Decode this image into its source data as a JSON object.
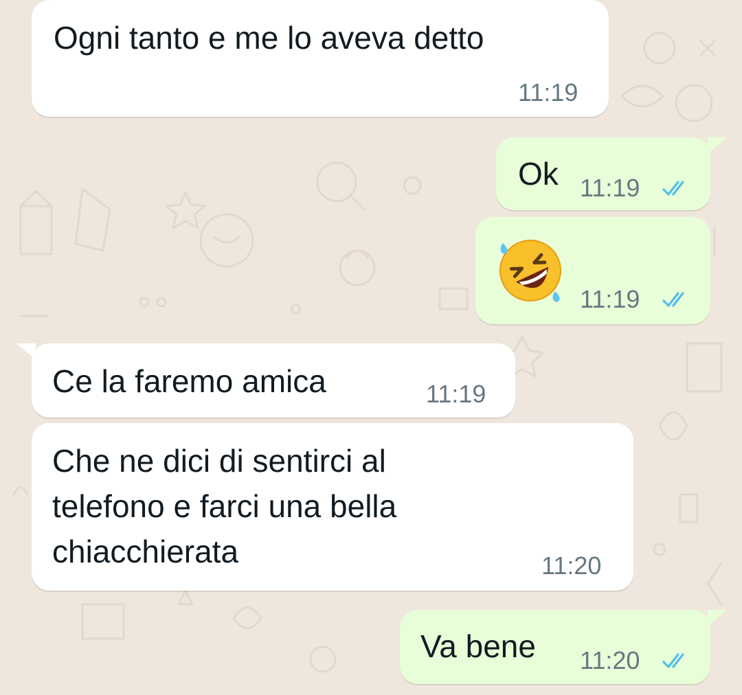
{
  "chat": {
    "messages": [
      {
        "direction": "incoming",
        "text": "Ogni tanto e me lo aveva detto",
        "time": "11:19"
      },
      {
        "direction": "outgoing",
        "text": "Ok",
        "time": "11:19",
        "status": "read-ticks"
      },
      {
        "direction": "outgoing",
        "emoji": "rolling-on-the-floor-laughing",
        "time": "11:19",
        "status": "read-ticks"
      },
      {
        "direction": "incoming",
        "text": "Ce la faremo amica",
        "time": "11:19"
      },
      {
        "direction": "incoming",
        "text": "Che ne dici di sentirci al\ntelefono e farci una bella\nchiacchierata",
        "time": "11:20"
      },
      {
        "direction": "outgoing",
        "text": "Va bene",
        "time": "11:20",
        "status": "read-ticks"
      }
    ]
  },
  "colors": {
    "wallpaper": "#efe7dd",
    "incoming_bubble": "#ffffff",
    "outgoing_bubble": "#e7fed8",
    "text": "#111b21",
    "timestamp": "#667781",
    "read_ticks": "#53bdeb"
  }
}
